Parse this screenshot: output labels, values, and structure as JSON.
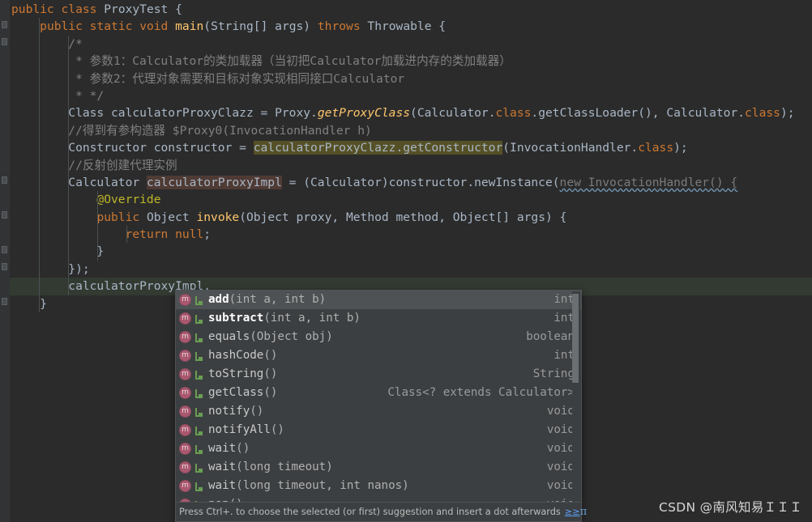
{
  "editor": {
    "theme": "darcula",
    "background": "#2b2b2b",
    "gutter_background": "#313335",
    "current_line_background": "#323a32",
    "lines": [
      {
        "id": "l1",
        "text": "public class ProxyTest {"
      },
      {
        "id": "l2",
        "text": "    public static void main(String[] args) throws Throwable {"
      },
      {
        "id": "l3",
        "text": "        /*"
      },
      {
        "id": "l4",
        "text": "         * 参数1：Calculator的类加载器（当初把Calculator加载进内存的类加载器）"
      },
      {
        "id": "l5",
        "text": "         * 参数2：代理对象需要和目标对象实现相同接口Calculator"
      },
      {
        "id": "l6",
        "text": "         * */"
      },
      {
        "id": "l7",
        "text": "        Class calculatorProxyClazz = Proxy.getProxyClass(Calculator.class.getClassLoader(), Calculator.class);"
      },
      {
        "id": "l8",
        "text": "        //得到有参构造器 $Proxy0(InvocationHandler h)"
      },
      {
        "id": "l9",
        "text": "        Constructor constructor = calculatorProxyClazz.getConstructor(InvocationHandler.class);"
      },
      {
        "id": "l10",
        "text": "        //反射创建代理实例"
      },
      {
        "id": "l11",
        "text": "        Calculator calculatorProxyImpl = (Calculator)constructor.newInstance(new InvocationHandler() {"
      },
      {
        "id": "l12",
        "text": "            @Override"
      },
      {
        "id": "l13",
        "text": "            public Object invoke(Object proxy, Method method, Object[] args) {"
      },
      {
        "id": "l14",
        "text": "                return null;"
      },
      {
        "id": "l15",
        "text": "            }"
      },
      {
        "id": "l16",
        "text": "        });"
      },
      {
        "id": "l17",
        "text": "        calculatorProxyImpl."
      },
      {
        "id": "l18",
        "text": "    }"
      }
    ],
    "highlights": {
      "get_constructor_call": "calculatorProxyClazz.getConstructor",
      "proxy_impl_identifier": "calculatorProxyImpl",
      "olive_color": "#555026",
      "brown_color": "#4f3a34"
    }
  },
  "completion_popup": {
    "selected_index": 0,
    "items": [
      {
        "icon": "method-icon",
        "modifier_icon": "interface-member-icon",
        "name": "add",
        "signature": "(int a, int b)",
        "type": "int",
        "bold": true
      },
      {
        "icon": "method-icon",
        "modifier_icon": "interface-member-icon",
        "name": "subtract",
        "signature": "(int a, int b)",
        "type": "int",
        "bold": true
      },
      {
        "icon": "method-icon",
        "modifier_icon": "interface-member-icon",
        "name": "equals",
        "signature": "(Object obj)",
        "type": "boolean",
        "bold": false
      },
      {
        "icon": "method-icon",
        "modifier_icon": "interface-member-icon",
        "name": "hashCode",
        "signature": "()",
        "type": "int",
        "bold": false
      },
      {
        "icon": "method-icon",
        "modifier_icon": "interface-member-icon",
        "name": "toString",
        "signature": "()",
        "type": "String",
        "bold": false
      },
      {
        "icon": "method-icon",
        "modifier_icon": "interface-member-icon",
        "name": "getClass",
        "signature": "()",
        "type": "Class<? extends Calculator>",
        "bold": false
      },
      {
        "icon": "method-icon",
        "modifier_icon": "interface-member-icon",
        "name": "notify",
        "signature": "()",
        "type": "void",
        "bold": false
      },
      {
        "icon": "method-icon",
        "modifier_icon": "interface-member-icon",
        "name": "notifyAll",
        "signature": "()",
        "type": "void",
        "bold": false
      },
      {
        "icon": "method-icon",
        "modifier_icon": "interface-member-icon",
        "name": "wait",
        "signature": "()",
        "type": "void",
        "bold": false
      },
      {
        "icon": "method-icon",
        "modifier_icon": "interface-member-icon",
        "name": "wait",
        "signature": "(long timeout)",
        "type": "void",
        "bold": false
      },
      {
        "icon": "method-icon",
        "modifier_icon": "interface-member-icon",
        "name": "wait",
        "signature": "(long timeout, int nanos)",
        "type": "void",
        "bold": false
      },
      {
        "icon": "method-icon",
        "modifier_icon": "interface-member-icon",
        "name": "nop",
        "signature": "()",
        "type": "void",
        "bold": false
      }
    ],
    "footer": {
      "hint": "Press Ctrl+. to choose the selected (or first) suggestion and insert a dot afterwards",
      "more_label": "≥≥",
      "settings_icon": "π"
    },
    "scrollbar": {
      "visible": true
    }
  },
  "watermark": {
    "text": "CSDN @南风知易ＩＩＩ"
  }
}
